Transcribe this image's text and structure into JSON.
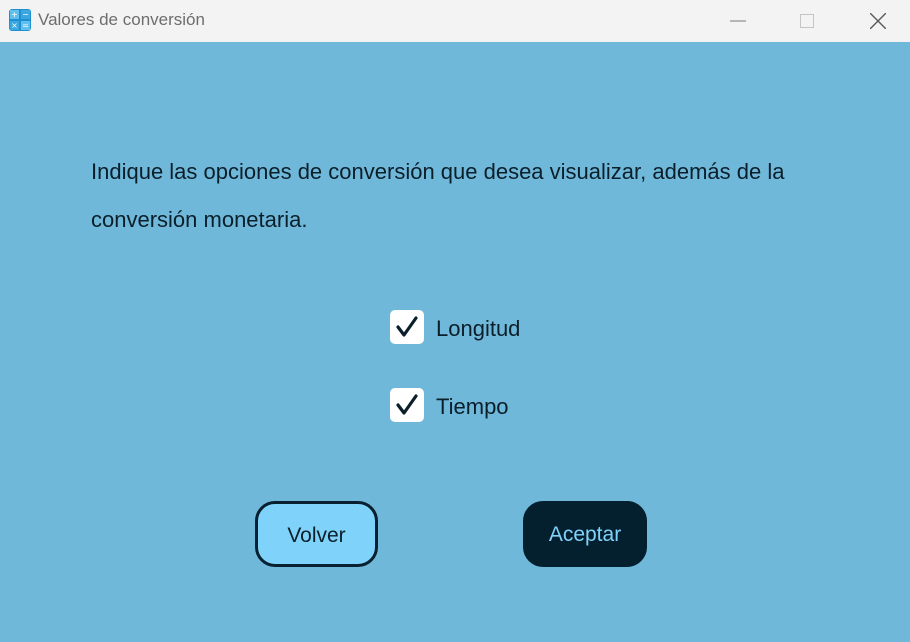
{
  "window": {
    "title": "Valores de conversión",
    "icon": "calculator-icon",
    "controls": [
      "minimize-icon",
      "maximize-icon",
      "close-icon"
    ]
  },
  "content": {
    "prompt": "Indique las opciones de conversión que desea visualizar, además de la conversión monetaria.",
    "options": [
      {
        "label": "Longitud",
        "checked": true
      },
      {
        "label": "Tiempo",
        "checked": true
      }
    ]
  },
  "buttons": {
    "back_label": "Volver",
    "accept_label": "Aceptar"
  },
  "colors": {
    "background": "#70b8da",
    "titlebar": "#f3f3f3",
    "back_button": "#7fd3fb",
    "accept_button": "#04202e",
    "text": "#0b1f2b"
  }
}
